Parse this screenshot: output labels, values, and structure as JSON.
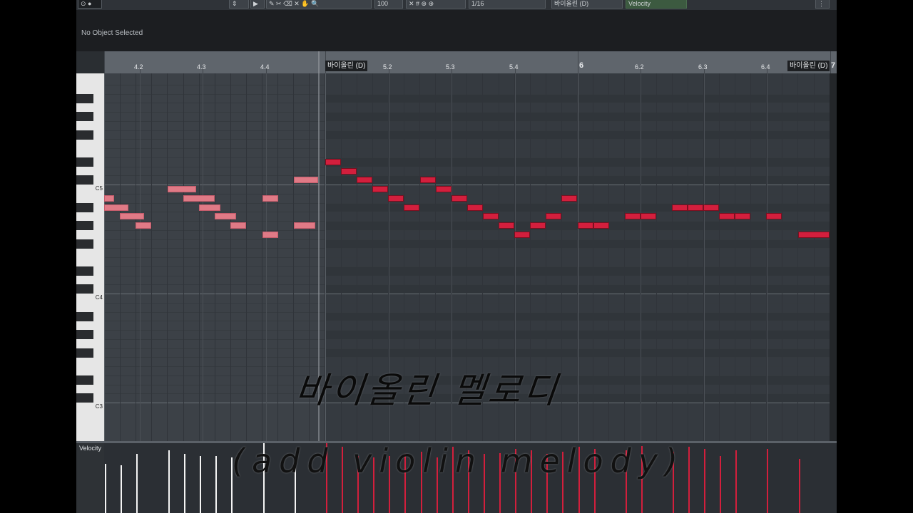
{
  "toolbar": {
    "quantize_value": "1/16",
    "length_value": "1/16",
    "velocity_value": "100",
    "part_name": "바이올린 (D)",
    "controller_lane": "Velocity"
  },
  "info_line": {
    "status_text": "No Object Selected"
  },
  "ruler": {
    "sub_ticks": [
      "4.2",
      "4.3",
      "4.4",
      "5.2",
      "5.3",
      "5.4",
      "6.2",
      "6.3",
      "6.4"
    ],
    "bar_labels": [
      "6",
      "7"
    ],
    "part_labels": [
      "바이올린 (D)",
      "바이올린 (D)"
    ]
  },
  "keyboard": {
    "octave_labels": [
      "C5",
      "C4",
      "C3"
    ]
  },
  "velocity_lane": {
    "label": "Velocity",
    "out_of_part_levels": [
      0.7,
      0.68,
      0.85,
      0.9,
      0.85,
      0.82,
      0.82,
      0.8,
      1.0,
      0.9,
      0.75
    ],
    "in_part_levels": [
      1.0,
      0.95,
      0.82,
      0.8,
      0.82,
      0.85,
      0.88,
      0.8,
      0.95,
      0.9,
      0.85,
      0.86,
      0.92,
      0.9,
      0.85,
      0.88,
      0.95,
      0.92,
      0.9,
      0.96,
      0.88,
      0.95,
      0.92,
      0.82,
      0.9,
      0.92,
      0.78
    ]
  },
  "overlay": {
    "korean_caption": "바이올린 멜로디",
    "english_caption": "(add violin melody)"
  },
  "colors": {
    "in_part_note": "#d31f3d",
    "out_of_part_note": "#e07a86",
    "grid_bg": "#3c4147",
    "ruler_bg": "#5f656c"
  }
}
